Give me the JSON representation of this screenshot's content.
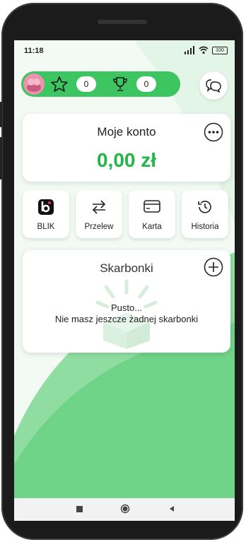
{
  "status": {
    "time": "11:18",
    "battery": "100"
  },
  "gamification": {
    "stars": "0",
    "trophies": "0",
    "icons": [
      "avatar",
      "star-icon",
      "trophy-icon"
    ]
  },
  "header": {
    "chat_icon": "chat-bubbles-icon"
  },
  "account": {
    "title": "Moje konto",
    "balance": "0,00 zł",
    "menu_icon": "more-dots-icon"
  },
  "actions": [
    {
      "label": "BLIK",
      "icon": "blik-icon"
    },
    {
      "label": "Przelew",
      "icon": "transfer-arrows-icon"
    },
    {
      "label": "Karta",
      "icon": "card-icon"
    },
    {
      "label": "Historia",
      "icon": "history-icon"
    }
  ],
  "piggy_banks": {
    "title": "Skarbonki",
    "empty_title": "Pusto...",
    "empty_text": "Nie masz jeszcze żadnej skarbonki",
    "add_icon": "plus-icon"
  },
  "colors": {
    "accent": "#3cc560",
    "balance": "#23b54a",
    "background_wave": "#6fd487"
  }
}
